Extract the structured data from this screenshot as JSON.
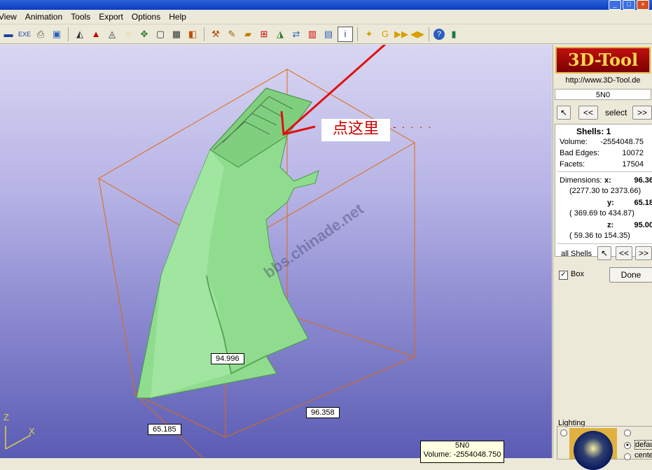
{
  "menu": [
    "View",
    "Animation",
    "Tools",
    "Export",
    "Options",
    "Help"
  ],
  "window_buttons": [
    "_",
    "□",
    "×"
  ],
  "toolbar_icons": [
    "save-icon",
    "export-exe-icon",
    "print-icon",
    "properties-icon",
    "measure-icon",
    "section-icon",
    "edit-icon",
    "rotate-icon",
    "move-icon",
    "box-icon",
    "cube-icon",
    "render-icon",
    "hammer-icon",
    "brush-icon",
    "ruler-icon",
    "analysis-icon",
    "surface-icon",
    "compare-icon",
    "wall-thickness-icon",
    "chart-icon",
    "shell-info-icon",
    "center-icon",
    "reset-icon",
    "play-icon",
    "mirror-icon",
    "help-icon",
    "exit-icon"
  ],
  "side": {
    "logo": "3D-Tool",
    "url": "http://www.3D-Tool.de",
    "name": "5N0",
    "prev": "<<",
    "select": "select",
    "next": ">>",
    "shells_label": "Shells: 1",
    "volume_label": "Volume:",
    "volume_value": "-2554048.75",
    "bad_edges_label": "Bad Edges:",
    "bad_edges_value": "10072",
    "facets_label": "Facets:",
    "facets_value": "17504",
    "dimensions_label": "Dimensions:",
    "x_label": "x:",
    "x_value": "96.36",
    "x_range": "(2277.30 to 2373.66)",
    "y_label": "y:",
    "y_value": "65.18",
    "y_range": "( 369.69 to  434.87)",
    "z_label": "z:",
    "z_value": "95.00",
    "z_range": "(  59.36 to  154.35)",
    "all_shells": "all Shells",
    "box_label": "Box",
    "box_checked": "✓",
    "done": "Done",
    "lighting": "Lighting",
    "light_opt1": "default",
    "light_opt2": "center"
  },
  "viewport": {
    "annotation": "点这里",
    "dots": "- · · · ·",
    "watermark": "bbs.chinade.net",
    "dim_z": "94.996",
    "dim_x": "96.358",
    "dim_y": "65.185",
    "axis_z": "Z",
    "axis_x": "X",
    "tooltip_name": "5N0",
    "tooltip_volume": "Volume: -2554048.750"
  }
}
